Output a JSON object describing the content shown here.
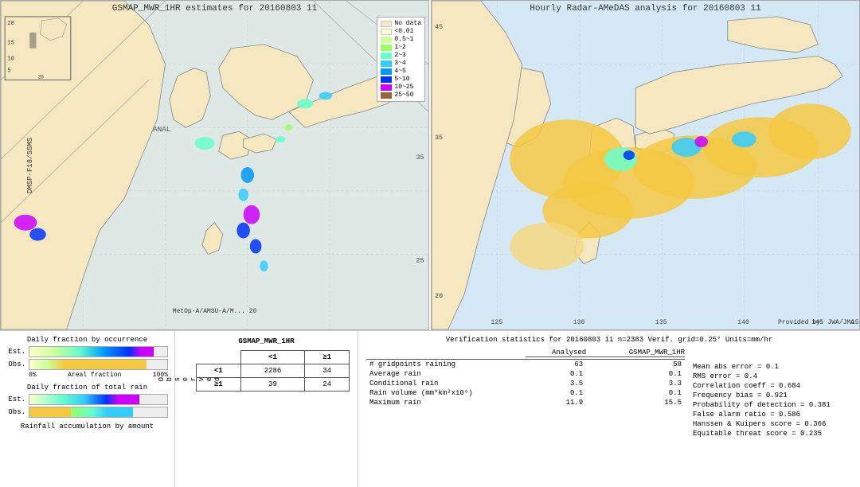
{
  "maps": {
    "left": {
      "title": "GSMAP_MWR_1HR estimates for 20160803 11",
      "side_label": "DMSP-F18/SSMS",
      "bottom_label": "MetOp-A/AMSU-A/M... 20",
      "legend": {
        "items": [
          {
            "label": "No data",
            "color": "#f5e8c0"
          },
          {
            "label": "<0.01",
            "color": "#ffffcc"
          },
          {
            "label": "0.5~1",
            "color": "#ccff99"
          },
          {
            "label": "1~2",
            "color": "#99ff66"
          },
          {
            "label": "2~3",
            "color": "#66ffcc"
          },
          {
            "label": "3~4",
            "color": "#33ccff"
          },
          {
            "label": "4~5",
            "color": "#0099ff"
          },
          {
            "label": "5~10",
            "color": "#0033ff"
          },
          {
            "label": "10~25",
            "color": "#cc00ff"
          },
          {
            "label": "25~50",
            "color": "#996633"
          }
        ]
      },
      "lat_labels": [
        "20",
        "15",
        "10",
        "5",
        "20"
      ],
      "lon_labels": [
        "20",
        "ANAL"
      ]
    },
    "right": {
      "title": "Hourly Radar-AMeDAS analysis for 20160803 11",
      "attribution": "Provided by: JWA/JMA",
      "lat_labels": [
        "45",
        "35",
        "20"
      ],
      "lon_labels": [
        "125",
        "130",
        "135",
        "140",
        "145",
        "15"
      ]
    }
  },
  "bottom": {
    "left": {
      "title1": "Daily fraction by occurrence",
      "title2": "Daily fraction of total rain",
      "title3": "Rainfall accumulation by amount",
      "est_label": "Est.",
      "obs_label": "Obs.",
      "axis_start": "0%",
      "axis_end": "Areal fraction",
      "axis_end2": "100%"
    },
    "mid": {
      "title": "GSMAP_MWR_1HR",
      "col_lt1": "<1",
      "col_ge1": "≥1",
      "row_lt1": "<1",
      "row_ge1": "≥1",
      "obs_label": "O\nb\ns\ne\nr\nv\ne\nd",
      "val_00": "2286",
      "val_01": "34",
      "val_10": "39",
      "val_11": "24"
    },
    "right": {
      "title": "Verification statistics for 20160803 11  n=2383  Verif. grid=0.25°  Units=mm/hr",
      "col_headers": [
        "Analysed",
        "GSMAP_MWR_1HR"
      ],
      "rows": [
        {
          "label": "# gridpoints raining",
          "analysed": "63",
          "gsmap": "58"
        },
        {
          "label": "Average rain",
          "analysed": "0.1",
          "gsmap": "0.1"
        },
        {
          "label": "Conditional rain",
          "analysed": "3.5",
          "gsmap": "3.3"
        },
        {
          "label": "Rain volume (mm*km²x10⁶)",
          "analysed": "0.1",
          "gsmap": "0.1"
        },
        {
          "label": "Maximum rain",
          "analysed": "11.9",
          "gsmap": "15.5"
        }
      ],
      "stats": [
        {
          "label": "Mean abs error = 0.1"
        },
        {
          "label": "RMS error = 0.4"
        },
        {
          "label": "Correlation coeff = 0.684"
        },
        {
          "label": "Frequency bias = 0.921"
        },
        {
          "label": "Probability of detection = 0.381"
        },
        {
          "label": "False alarm ratio = 0.586"
        },
        {
          "label": "Hanssen & Kuipers score = 0.366"
        },
        {
          "label": "Equitable threat score = 0.235"
        }
      ]
    }
  }
}
